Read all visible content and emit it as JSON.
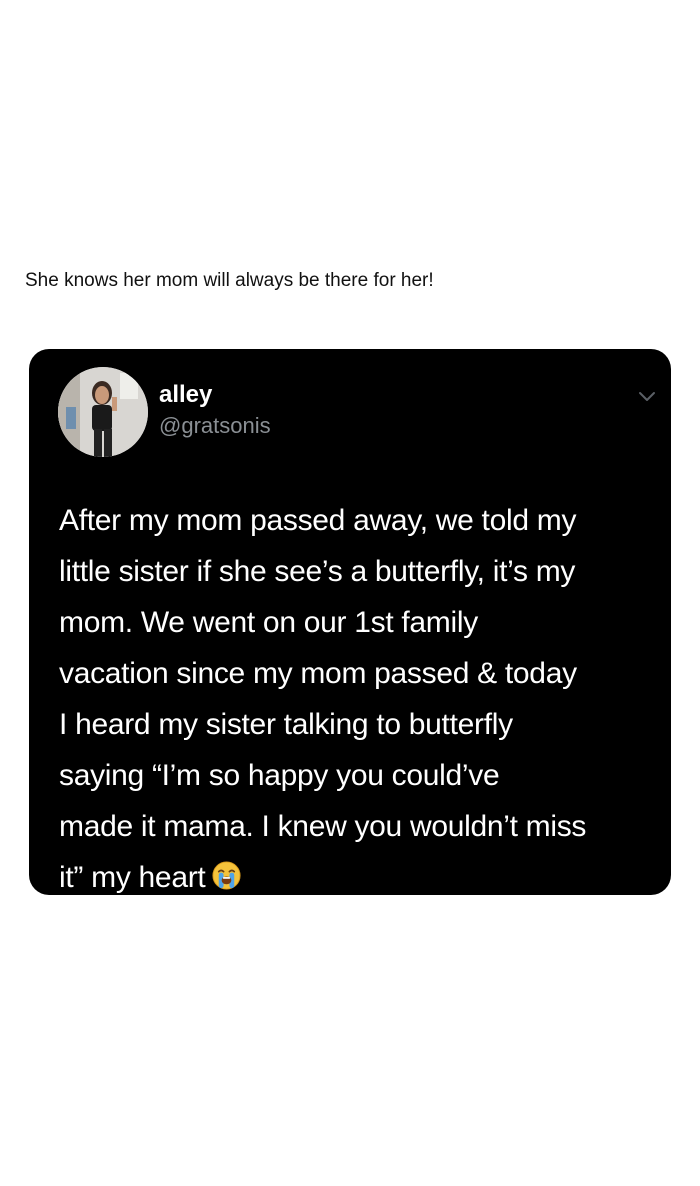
{
  "caption": "She knows her mom will always be there for her!",
  "tweet": {
    "author_name": "alley",
    "author_handle": "@gratsonis",
    "avatar_icon": "profile-photo",
    "menu_icon": "chevron-down-icon",
    "lines": [
      "After my mom passed away, we told my",
      "little sister if she see’s a butterfly, it’s my",
      "mom. We went on our 1st family",
      "vacation since my mom passed & today",
      "I heard my sister talking to butterfly",
      "saying “I’m so happy you could’ve",
      "made it mama. I knew you wouldn’t miss",
      "it” my heart"
    ],
    "emoji": "loudly-crying-face-emoji",
    "colors": {
      "card_background": "#000000",
      "text": "#ffffff",
      "handle": "#8a8f94",
      "emoji": "#f5c33b"
    }
  }
}
